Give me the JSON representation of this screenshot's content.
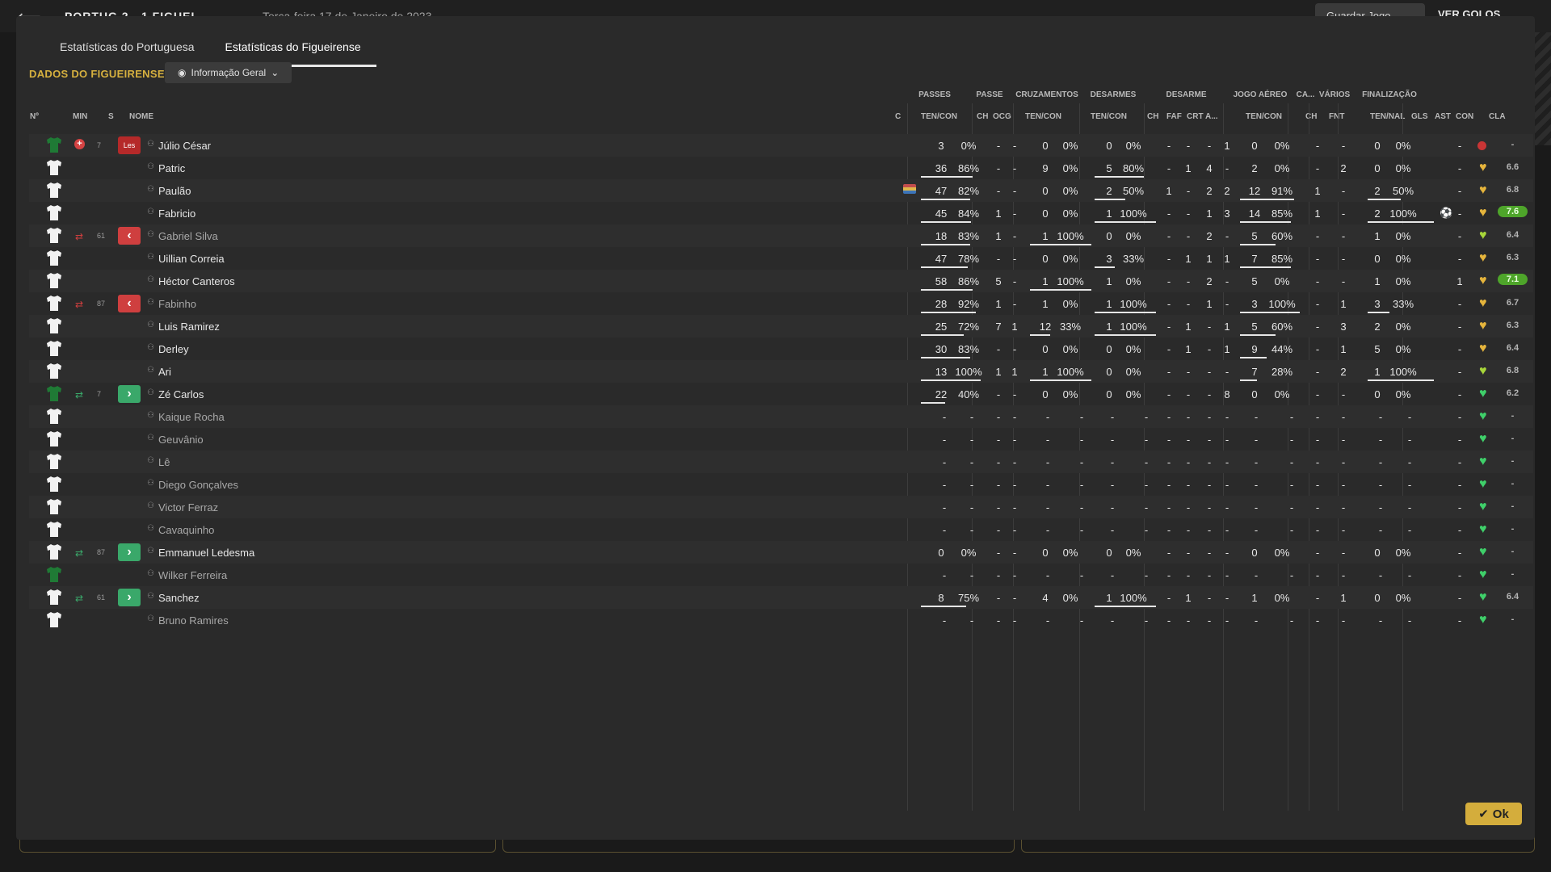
{
  "background": {
    "score": "PORTUG  2 - 1  FIGUEI",
    "date": "Terça-feira 17 de Janeiro de 2023",
    "save_label": "Guardar Jogo",
    "goals_label": "VER GOLOS"
  },
  "tabs": [
    "Estatísticas do Portuguesa",
    "Estatísticas do Figueirense"
  ],
  "section_title": "DADOS DO FIGUEIRENSE",
  "view_select": "Informação Geral",
  "group_headers": [
    "PASSES",
    "PASSE",
    "CRUZAMENTOS",
    "DESARMES",
    "DESARME",
    "JOGO AÉREO",
    "CA...",
    "VÁRIOS",
    "FINALIZAÇÃO"
  ],
  "column_headers": {
    "no": "Nº",
    "min": "MIN",
    "s": "S",
    "nome": "NOME",
    "c": "C",
    "passes": "TEN/CON",
    "passe_ch": "CH",
    "passe_ocg": "OCG",
    "cruz": "TEN/CON",
    "desarmes": "TEN/CON",
    "desarme_ch": "CH",
    "desarme_faf": "FAF",
    "desarme_crt": "CRT",
    "desarme_a": "A...",
    "aereo": "TEN/CON",
    "ca_ch": "CH",
    "varios_fnt": "FNT",
    "final": "TEN/NAL",
    "gls": "GLS",
    "ast": "AST",
    "con": "CON",
    "cla": "CLA"
  },
  "ok_label": "Ok",
  "colors": {
    "accent": "#d7b13f",
    "good": "#4ea52a",
    "sub_off": "#cf3f3f",
    "sub_on": "#3aa86a"
  },
  "players": [
    {
      "name": "Júlio César",
      "shirt": "green",
      "min": "7",
      "status": "Les",
      "injury": true,
      "pass": [
        "3",
        "0%",
        0
      ],
      "ch": "-",
      "ocg": "-",
      "cruz": [
        "0",
        "0%",
        0
      ],
      "des": [
        "0",
        "0%",
        0
      ],
      "dch": "-",
      "faf": "-",
      "crt": "-",
      "a": "1",
      "aer": [
        "0",
        "0%",
        0
      ],
      "cach": "-",
      "fnt": "-",
      "fin": [
        "0",
        "0%",
        0
      ],
      "gls": "",
      "ast": "-",
      "con": "red",
      "cla": "-"
    },
    {
      "name": "Patric",
      "shirt": "white",
      "min": "",
      "status": "",
      "pass": [
        "36",
        "86%",
        0.86
      ],
      "ch": "-",
      "ocg": "-",
      "cruz": [
        "9",
        "0%",
        0
      ],
      "des": [
        "5",
        "80%",
        0.8
      ],
      "dch": "-",
      "faf": "1",
      "crt": "4",
      "a": "-",
      "aer": [
        "2",
        "0%",
        0
      ],
      "cach": "-",
      "fnt": "2",
      "fin": [
        "0",
        "0%",
        0
      ],
      "gls": "",
      "ast": "-",
      "con": "gold",
      "cla": "6.6"
    },
    {
      "name": "Paulão",
      "shirt": "white",
      "min": "",
      "status": "",
      "fan": true,
      "pass": [
        "47",
        "82%",
        0.82
      ],
      "ch": "-",
      "ocg": "-",
      "cruz": [
        "0",
        "0%",
        0
      ],
      "des": [
        "2",
        "50%",
        0.5
      ],
      "dch": "1",
      "faf": "-",
      "crt": "2",
      "a": "2",
      "aer": [
        "12",
        "91%",
        0.91
      ],
      "cach": "1",
      "fnt": "-",
      "fin": [
        "2",
        "50%",
        0.5
      ],
      "gls": "",
      "ast": "-",
      "con": "gold",
      "cla": "6.8"
    },
    {
      "name": "Fabricio",
      "shirt": "white",
      "min": "",
      "status": "",
      "pass": [
        "45",
        "84%",
        0.84
      ],
      "ch": "1",
      "ocg": "-",
      "cruz": [
        "0",
        "0%",
        0
      ],
      "des": [
        "1",
        "100%",
        1
      ],
      "dch": "-",
      "faf": "-",
      "crt": "1",
      "a": "3",
      "aer": [
        "14",
        "85%",
        0.85
      ],
      "cach": "1",
      "fnt": "-",
      "fin": [
        "2",
        "100%",
        1
      ],
      "gls": "ball",
      "ast": "-",
      "con": "gold",
      "cla": "7.6",
      "cla_hi": true
    },
    {
      "name": "Gabriel Silva",
      "shirt": "white",
      "min": "61",
      "status": "off",
      "dim": true,
      "pass": [
        "18",
        "83%",
        0.83
      ],
      "ch": "1",
      "ocg": "-",
      "cruz": [
        "1",
        "100%",
        1
      ],
      "des": [
        "0",
        "0%",
        0
      ],
      "dch": "-",
      "faf": "-",
      "crt": "2",
      "a": "-",
      "aer": [
        "5",
        "60%",
        0.6
      ],
      "cach": "-",
      "fnt": "-",
      "fin": [
        "1",
        "0%",
        0
      ],
      "gls": "",
      "ast": "-",
      "con": "lime",
      "cla": "6.4"
    },
    {
      "name": "Uillian Correia",
      "shirt": "white",
      "min": "",
      "status": "",
      "pass": [
        "47",
        "78%",
        0.78
      ],
      "ch": "-",
      "ocg": "-",
      "cruz": [
        "0",
        "0%",
        0
      ],
      "des": [
        "3",
        "33%",
        0.33
      ],
      "dch": "-",
      "faf": "1",
      "crt": "1",
      "a": "1",
      "aer": [
        "7",
        "85%",
        0.85
      ],
      "cach": "-",
      "fnt": "-",
      "fin": [
        "0",
        "0%",
        0
      ],
      "gls": "",
      "ast": "-",
      "con": "gold",
      "cla": "6.3"
    },
    {
      "name": "Héctor Canteros",
      "shirt": "white",
      "min": "",
      "status": "",
      "pass": [
        "58",
        "86%",
        0.86
      ],
      "ch": "5",
      "ocg": "-",
      "cruz": [
        "1",
        "100%",
        1
      ],
      "des": [
        "1",
        "0%",
        0
      ],
      "dch": "-",
      "faf": "-",
      "crt": "2",
      "a": "-",
      "aer": [
        "5",
        "0%",
        0
      ],
      "cach": "-",
      "fnt": "-",
      "fin": [
        "1",
        "0%",
        0
      ],
      "gls": "",
      "ast": "1",
      "con": "gold",
      "cla": "7.1",
      "cla_hi": true
    },
    {
      "name": "Fabinho",
      "shirt": "white",
      "min": "87",
      "status": "off",
      "dim": true,
      "pass": [
        "28",
        "92%",
        0.92
      ],
      "ch": "1",
      "ocg": "-",
      "cruz": [
        "1",
        "0%",
        0
      ],
      "des": [
        "1",
        "100%",
        1
      ],
      "dch": "-",
      "faf": "-",
      "crt": "1",
      "a": "-",
      "aer": [
        "3",
        "100%",
        1
      ],
      "cach": "-",
      "fnt": "1",
      "fin": [
        "3",
        "33%",
        0.33
      ],
      "gls": "",
      "ast": "-",
      "con": "gold",
      "cla": "6.7"
    },
    {
      "name": "Luis Ramirez",
      "shirt": "white",
      "min": "",
      "status": "",
      "pass": [
        "25",
        "72%",
        0.72
      ],
      "ch": "7",
      "ocg": "1",
      "cruz": [
        "12",
        "33%",
        0.33
      ],
      "des": [
        "1",
        "100%",
        1
      ],
      "dch": "-",
      "faf": "1",
      "crt": "-",
      "a": "1",
      "aer": [
        "5",
        "60%",
        0.6
      ],
      "cach": "-",
      "fnt": "3",
      "fin": [
        "2",
        "0%",
        0
      ],
      "gls": "",
      "ast": "-",
      "con": "gold",
      "cla": "6.3"
    },
    {
      "name": "Derley",
      "shirt": "white",
      "min": "",
      "status": "",
      "pass": [
        "30",
        "83%",
        0.83
      ],
      "ch": "-",
      "ocg": "-",
      "cruz": [
        "0",
        "0%",
        0
      ],
      "des": [
        "0",
        "0%",
        0
      ],
      "dch": "-",
      "faf": "1",
      "crt": "-",
      "a": "1",
      "aer": [
        "9",
        "44%",
        0.44
      ],
      "cach": "-",
      "fnt": "1",
      "fin": [
        "5",
        "0%",
        0
      ],
      "gls": "",
      "ast": "-",
      "con": "gold",
      "cla": "6.4"
    },
    {
      "name": "Ari",
      "shirt": "white",
      "min": "",
      "status": "",
      "pass": [
        "13",
        "100%",
        1
      ],
      "ch": "1",
      "ocg": "1",
      "cruz": [
        "1",
        "100%",
        1
      ],
      "des": [
        "0",
        "0%",
        0
      ],
      "dch": "-",
      "faf": "-",
      "crt": "-",
      "a": "-",
      "aer": [
        "7",
        "28%",
        0.28
      ],
      "cach": "-",
      "fnt": "2",
      "fin": [
        "1",
        "100%",
        1
      ],
      "gls": "",
      "ast": "-",
      "con": "lime",
      "cla": "6.8"
    },
    {
      "name": "Zé Carlos",
      "shirt": "green",
      "min": "7",
      "status": "on",
      "pass": [
        "22",
        "40%",
        0.4
      ],
      "ch": "-",
      "ocg": "-",
      "cruz": [
        "0",
        "0%",
        0
      ],
      "des": [
        "0",
        "0%",
        0
      ],
      "dch": "-",
      "faf": "-",
      "crt": "-",
      "a": "8",
      "aer": [
        "0",
        "0%",
        0
      ],
      "cach": "-",
      "fnt": "-",
      "fin": [
        "0",
        "0%",
        0
      ],
      "gls": "",
      "ast": "-",
      "con": "green",
      "cla": "6.2"
    },
    {
      "name": "Kaique Rocha",
      "shirt": "white",
      "empty": true,
      "dim": true,
      "con": "green",
      "cla": "-"
    },
    {
      "name": "Geuvânio",
      "shirt": "white",
      "empty": true,
      "dim": true,
      "con": "green",
      "cla": "-"
    },
    {
      "name": "Lê",
      "shirt": "white",
      "empty": true,
      "dim": true,
      "con": "green",
      "cla": "-"
    },
    {
      "name": "Diego Gonçalves",
      "shirt": "white",
      "empty": true,
      "dim": true,
      "con": "green",
      "cla": "-"
    },
    {
      "name": "Victor Ferraz",
      "shirt": "white",
      "empty": true,
      "dim": true,
      "con": "green",
      "cla": "-"
    },
    {
      "name": "Cavaquinho",
      "shirt": "white",
      "empty": true,
      "dim": true,
      "con": "green",
      "cla": "-"
    },
    {
      "name": "Emmanuel Ledesma",
      "shirt": "white",
      "min": "87",
      "status": "on",
      "pass": [
        "0",
        "0%",
        0
      ],
      "ch": "-",
      "ocg": "-",
      "cruz": [
        "0",
        "0%",
        0
      ],
      "des": [
        "0",
        "0%",
        0
      ],
      "dch": "-",
      "faf": "-",
      "crt": "-",
      "a": "-",
      "aer": [
        "0",
        "0%",
        0
      ],
      "cach": "-",
      "fnt": "-",
      "fin": [
        "0",
        "0%",
        0
      ],
      "gls": "",
      "ast": "-",
      "con": "green",
      "cla": "-"
    },
    {
      "name": "Wilker Ferreira",
      "shirt": "green",
      "empty": true,
      "dim": true,
      "con": "green",
      "cla": "-"
    },
    {
      "name": "Sanchez",
      "shirt": "white",
      "min": "61",
      "status": "on",
      "pass": [
        "8",
        "75%",
        0.75
      ],
      "ch": "-",
      "ocg": "-",
      "cruz": [
        "4",
        "0%",
        0
      ],
      "des": [
        "1",
        "100%",
        1
      ],
      "dch": "-",
      "faf": "1",
      "crt": "-",
      "a": "-",
      "aer": [
        "1",
        "0%",
        0
      ],
      "cach": "-",
      "fnt": "1",
      "fin": [
        "0",
        "0%",
        0
      ],
      "gls": "",
      "ast": "-",
      "con": "green",
      "cla": "6.4"
    },
    {
      "name": "Bruno Ramires",
      "shirt": "white",
      "empty": true,
      "dim": true,
      "con": "green",
      "cla": "-"
    }
  ]
}
